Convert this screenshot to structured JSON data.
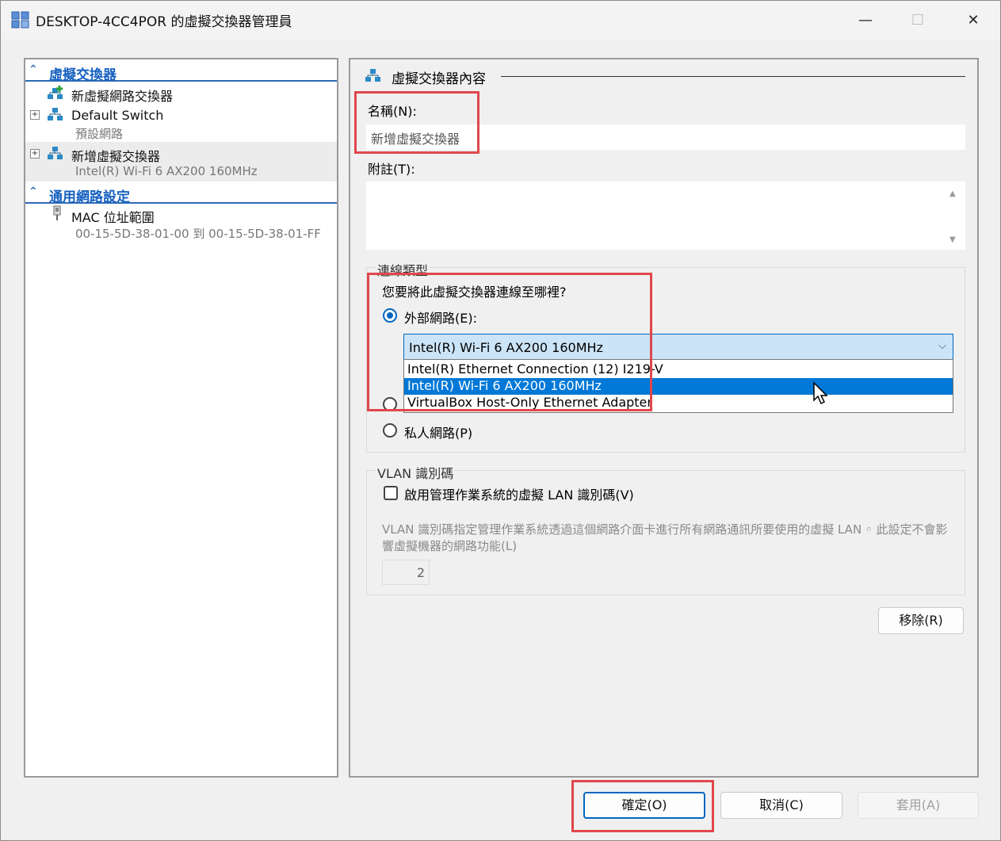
{
  "window": {
    "title": "DESKTOP-4CC4POR 的虛擬交換器管理員",
    "minimize": "—",
    "maximize": "☐",
    "close": "✕"
  },
  "left_pane": {
    "section1_title": "虛擬交換器",
    "new_switch": "新虛擬網路交換器",
    "default_switch": {
      "name": "Default Switch",
      "sub": "預設網路"
    },
    "added_switch": {
      "name": "新增虛擬交換器",
      "sub": "Intel(R) Wi-Fi 6 AX200 160MHz"
    },
    "section2_title": "通用網路設定",
    "mac_range": {
      "name": "MAC 位址範圍",
      "sub": "00-15-5D-38-01-00 到 00-15-5D-38-01-FF"
    }
  },
  "right_pane": {
    "section_title": "虛擬交換器內容",
    "name_label": "名稱(N):",
    "name_value": "新增虛擬交換器",
    "notes_label": "附註(T):",
    "conn_group_title": "連線類型",
    "conn_question": "您要將此虛擬交換器連線至哪裡?",
    "external_label": "外部網路(E):",
    "private_label": "私人網路(P)",
    "adapter_selected": "Intel(R) Wi-Fi 6 AX200 160MHz",
    "adapter_options": [
      "Intel(R) Ethernet Connection (12) I219-V",
      "Intel(R) Wi-Fi 6 AX200 160MHz",
      "VirtualBox Host-Only Ethernet Adapter"
    ],
    "vlan_group_title": "VLAN 識別碼",
    "vlan_checkbox_label": "啟用管理作業系統的虛擬 LAN 識別碼(V)",
    "vlan_desc": "VLAN 識別碼指定管理作業系統透過這個網路介面卡進行所有網路通訊所要使用的虛擬 LAN ◦ 此設定不會影響虛擬機器的網路功能(L)",
    "vlan_value": "2",
    "remove_button": "移除(R)"
  },
  "footer": {
    "ok": "確定(O)",
    "cancel": "取消(C)",
    "apply": "套用(A)"
  },
  "colors": {
    "accent": "#0067c0",
    "highlight": "#e0474c",
    "selection": "#0078d7",
    "section_header": "#1560c0"
  }
}
